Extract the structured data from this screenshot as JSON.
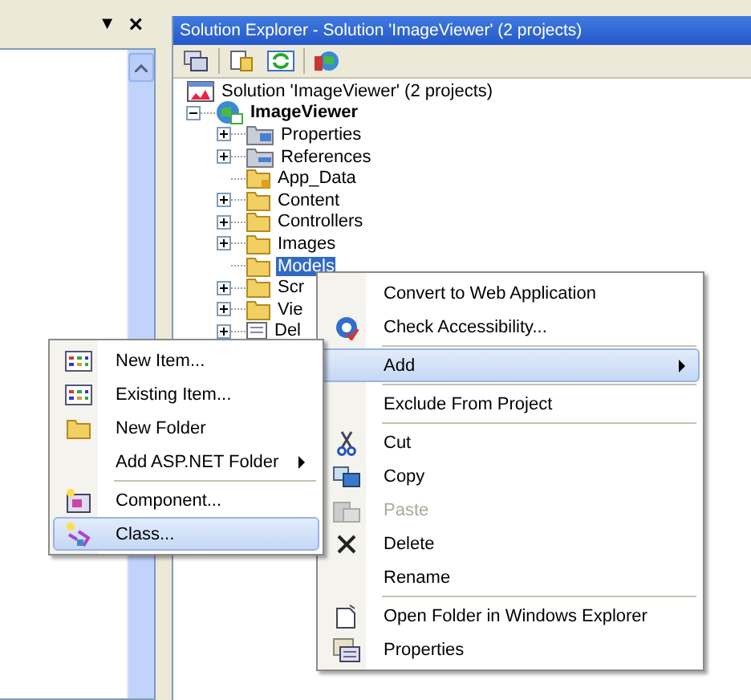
{
  "left_panel": {
    "dropdown_glyph": "▼",
    "close_glyph": "×"
  },
  "window": {
    "title": "Solution Explorer - Solution 'ImageViewer' (2 projects)"
  },
  "tree": [
    {
      "label": "Solution 'ImageViewer' (2 projects)",
      "kind": "solution",
      "selected": false,
      "children": [
        {
          "label": "ImageViewer",
          "kind": "project",
          "expanded": true,
          "selected": false,
          "children": [
            {
              "label": "Properties",
              "kind": "properties",
              "expanded": false,
              "selected": false
            },
            {
              "label": "References",
              "kind": "references",
              "expanded": false,
              "selected": false
            },
            {
              "label": "App_Data",
              "kind": "special-folder",
              "selected": false
            },
            {
              "label": "Content",
              "kind": "folder",
              "expanded": false,
              "selected": false
            },
            {
              "label": "Controllers",
              "kind": "folder",
              "expanded": false,
              "selected": false
            },
            {
              "label": "Images",
              "kind": "folder",
              "expanded": false,
              "selected": false
            },
            {
              "label": "Models",
              "kind": "folder",
              "selected": true
            },
            {
              "label": "Scr",
              "kind": "folder",
              "expanded": false,
              "selected": false
            },
            {
              "label": "Vie",
              "kind": "folder",
              "expanded": false,
              "selected": false
            },
            {
              "label": "Del",
              "kind": "file",
              "expanded": false,
              "selected": false
            }
          ]
        }
      ]
    }
  ],
  "context_menu": [
    {
      "kind": "item",
      "label": "Convert to Web Application",
      "selected": false,
      "disabled": false,
      "submenu": false
    },
    {
      "kind": "item",
      "label": "Check Accessibility...",
      "selected": false,
      "disabled": false,
      "submenu": false
    },
    {
      "kind": "separator"
    },
    {
      "kind": "item",
      "label": "Add",
      "selected": true,
      "disabled": false,
      "submenu": true
    },
    {
      "kind": "separator"
    },
    {
      "kind": "item",
      "label": "Exclude From Project",
      "selected": false,
      "disabled": false,
      "submenu": false
    },
    {
      "kind": "separator"
    },
    {
      "kind": "item",
      "label": "Cut",
      "selected": false,
      "disabled": false,
      "submenu": false
    },
    {
      "kind": "item",
      "label": "Copy",
      "selected": false,
      "disabled": false,
      "submenu": false
    },
    {
      "kind": "item",
      "label": "Paste",
      "selected": false,
      "disabled": true,
      "submenu": false
    },
    {
      "kind": "item",
      "label": "Delete",
      "selected": false,
      "disabled": false,
      "submenu": false
    },
    {
      "kind": "item",
      "label": "Rename",
      "selected": false,
      "disabled": false,
      "submenu": false
    },
    {
      "kind": "separator"
    },
    {
      "kind": "item",
      "label": "Open Folder in Windows Explorer",
      "selected": false,
      "disabled": false,
      "submenu": false
    },
    {
      "kind": "item",
      "label": "Properties",
      "selected": false,
      "disabled": false,
      "submenu": false
    }
  ],
  "add_submenu": [
    {
      "kind": "item",
      "label": "New Item...",
      "selected": false,
      "disabled": false,
      "submenu": false
    },
    {
      "kind": "item",
      "label": "Existing Item...",
      "selected": false,
      "disabled": false,
      "submenu": false
    },
    {
      "kind": "item",
      "label": "New Folder",
      "selected": false,
      "disabled": false,
      "submenu": false
    },
    {
      "kind": "item",
      "label": "Add ASP.NET Folder",
      "selected": false,
      "disabled": false,
      "submenu": true
    },
    {
      "kind": "separator"
    },
    {
      "kind": "item",
      "label": "Component...",
      "selected": false,
      "disabled": false,
      "submenu": false
    },
    {
      "kind": "item",
      "label": "Class...",
      "selected": true,
      "disabled": false,
      "submenu": false
    }
  ]
}
